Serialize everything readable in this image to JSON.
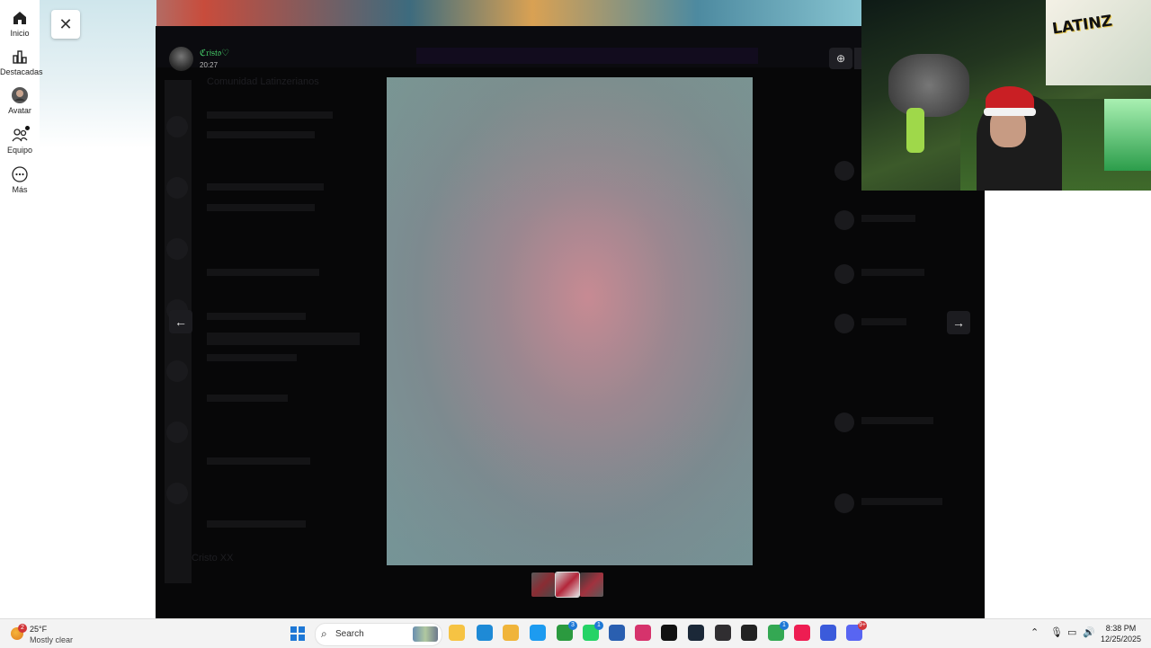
{
  "leftnav": {
    "items": [
      {
        "label": "Inicio",
        "icon": "home-icon"
      },
      {
        "label": "Destacadas",
        "icon": "chart-icon"
      },
      {
        "label": "Avatar",
        "icon": "avatar-icon"
      },
      {
        "label": "Equipo",
        "icon": "team-icon"
      },
      {
        "label": "Más",
        "icon": "more-icon"
      }
    ]
  },
  "viewer": {
    "username": "ℭ𝔯𝔦𝔰𝔱𝔬♡",
    "time": "20:27",
    "close_glyph": "✕",
    "zoom_glyph": "⊕",
    "prev_glyph": "←",
    "next_glyph": "→",
    "background_ghost": {
      "server_name": "Comunidad Latinzerianos",
      "user_name": "Cristo XX"
    }
  },
  "taskbar": {
    "weather_temp": "25°F",
    "weather_condition": "Mostly clear",
    "weather_badge": "2",
    "search_label": "Search",
    "search_icon": "search-icon",
    "apps": [
      {
        "name": "file-explorer-icon",
        "color": "#f6c343"
      },
      {
        "name": "edge-icon",
        "color": "#1e8ad6"
      },
      {
        "name": "folder-icon",
        "color": "#f0b43a"
      },
      {
        "name": "twitter-icon",
        "color": "#1d9bf0"
      },
      {
        "name": "xbox-icon",
        "color": "#2b9a3f",
        "badge": "3"
      },
      {
        "name": "whatsapp-icon",
        "color": "#25d366",
        "badge": "1"
      },
      {
        "name": "store-icon",
        "color": "#2a5fb0"
      },
      {
        "name": "instagram-icon",
        "color": "#d6336c"
      },
      {
        "name": "tiktok-icon",
        "color": "#111111"
      },
      {
        "name": "steam-icon",
        "color": "#1b2838"
      },
      {
        "name": "obs-icon",
        "color": "#302e31"
      },
      {
        "name": "epic-icon",
        "color": "#222222"
      },
      {
        "name": "chrome-icon",
        "color": "#34a853",
        "badge": "1"
      },
      {
        "name": "tiktok-live-icon",
        "color": "#ee1d52"
      },
      {
        "name": "app-icon",
        "color": "#3b5bdb"
      },
      {
        "name": "discord-icon",
        "color": "#5865f2",
        "badge": "9+"
      }
    ],
    "clock_time": "8:38 PM",
    "clock_date": "12/25/2025"
  }
}
